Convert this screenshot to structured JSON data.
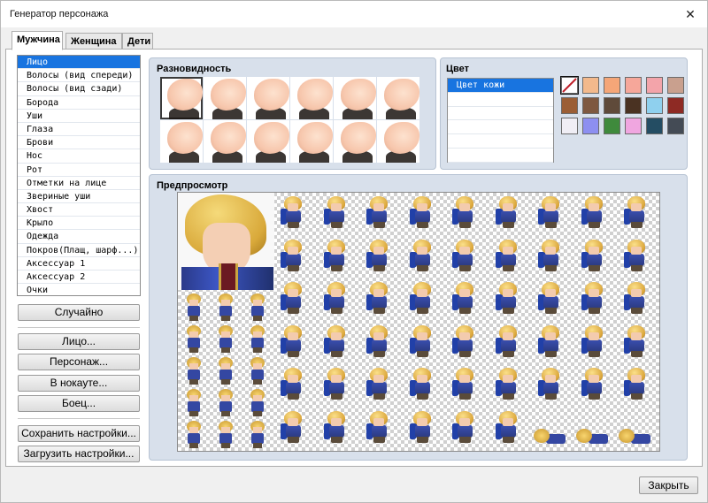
{
  "window": {
    "title": "Генератор персонажа",
    "close_glyph": "✕"
  },
  "tabs": [
    {
      "label": "Мужчина",
      "active": true
    },
    {
      "label": "Женщина",
      "active": false
    },
    {
      "label": "Дети",
      "active": false
    }
  ],
  "parts_list": {
    "items": [
      "Лицо",
      "Волосы (вид спереди)",
      "Волосы (вид сзади)",
      "Борода",
      "Уши",
      "Глаза",
      "Брови",
      "Нос",
      "Рот",
      "Отметки на лице",
      "Звериные уши",
      "Хвост",
      "Крыло",
      "Одежда",
      "Покров(Плащ, шарф...)",
      "Аксессуар 1",
      "Аксессуар 2",
      "Очки"
    ],
    "selected_index": 0
  },
  "buttons": {
    "random": "Случайно",
    "face": "Лицо...",
    "character": "Персонаж...",
    "knocked_out": "В нокауте...",
    "fighter": "Боец...",
    "save_settings": "Сохранить настройки...",
    "load_settings": "Загрузить настройки...",
    "close": "Закрыть"
  },
  "variety": {
    "title": "Разновидность",
    "count": 12,
    "selected_index": 0
  },
  "color": {
    "title": "Цвет",
    "list": [
      "Цвет кожи",
      "",
      "",
      "",
      "",
      ""
    ],
    "selected_index": 0,
    "swatches": [
      "none",
      "#f3b98c",
      "#f5a678",
      "#f6a79a",
      "#f3a4aa",
      "#c9a08e",
      "#9b5e35",
      "#7e5840",
      "#5f4a3a",
      "#4a3222",
      "#8fd0ee",
      "#8e2a24",
      "#f0eef5",
      "#8d8ff0",
      "#3f8a3c",
      "#f0a6e0",
      "#244d63",
      "#444b55"
    ]
  },
  "preview": {
    "title": "Предпросмотр"
  }
}
